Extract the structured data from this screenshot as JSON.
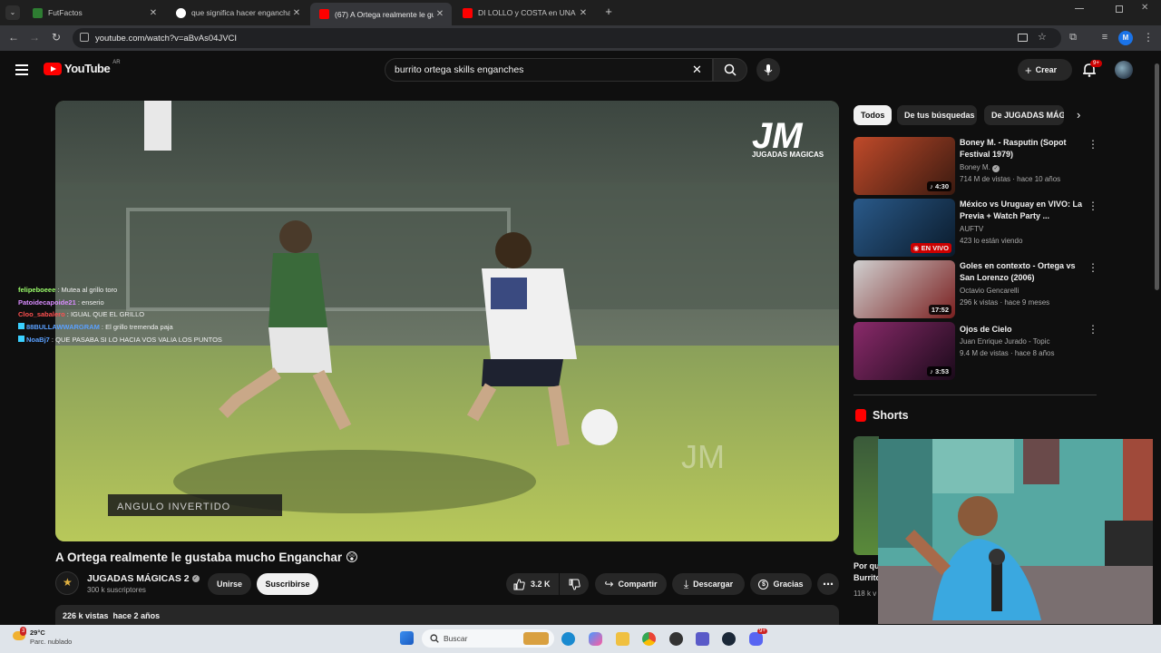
{
  "browser": {
    "tabs": [
      {
        "title": "FutFactos",
        "favicon_color": "#2e7d32"
      },
      {
        "title": "que significa hacer enganchar -",
        "favicon_color": "#ffffff"
      },
      {
        "title": "(67) A Ortega realmente le gust",
        "favicon_color": "#ff0000"
      },
      {
        "title": "DI LOLLO y COSTA en UNA BOM",
        "favicon_color": "#ff0000"
      }
    ],
    "active_tab_index": 2,
    "new_tab_icon": "plus-icon",
    "url": "youtube.com/watch?v=aBvAs04JVCI",
    "profile_initial": "M"
  },
  "youtube": {
    "logo_word": "YouTube",
    "country_code": "AR",
    "search_query": "burrito ortega skills enganches",
    "create_label": "Crear",
    "notification_badge": "9+",
    "player": {
      "watermark": "JM",
      "watermark_sub": "JUGADAS MAGICAS",
      "caption_overlay": "ANGULO INVERTIDO"
    },
    "chat_overlay": [
      {
        "user": "felipeboeee",
        "user_color": "#9cff6b",
        "message": "Mutea al grillo toro",
        "has_icon": false
      },
      {
        "user": "Patoidecapoide21",
        "user_color": "#d98cff",
        "message": "enserio",
        "has_icon": false
      },
      {
        "user": "Cloo_sabalero",
        "user_color": "#ff5050",
        "message": "IGUAL QUE EL GRILLO",
        "has_icon": false
      },
      {
        "user": "88BULLAWWARGRAM",
        "user_color": "#5aa0ff",
        "message": "El grillo tremenda paja",
        "has_icon": true
      },
      {
        "user": "NoaBj7",
        "user_color": "#5aa0ff",
        "message": "QUE PASABA SI LO HACIA VOS VALIA LOS PUNTOS",
        "has_icon": true
      }
    ],
    "video": {
      "title": "A Ortega realmente le gustaba mucho Enganchar 😲",
      "channel": "JUGADAS MÁGICAS 2",
      "subscribers": "300 k suscriptores",
      "join_label": "Unirse",
      "subscribe_label": "Suscribirse",
      "likes": "3.2 K",
      "share_label": "Compartir",
      "download_label": "Descargar",
      "thanks_label": "Gracias",
      "views_date": "226 k vistas  hace 2 años"
    },
    "chips": [
      "Todos",
      "De tus búsquedas",
      "De JUGADAS MÁGICAS"
    ],
    "recommendations": [
      {
        "title": "Boney M. - Rasputin (Sopot Festival 1979)",
        "channel": "Boney M.",
        "verified": true,
        "meta": "714 M de vistas · hace 10 años",
        "duration": "4:30",
        "live": false,
        "thumb_a": "#c04a2a",
        "thumb_b": "#3a1a10"
      },
      {
        "title": "México vs Uruguay en VIVO: La Previa + Watch Party ...",
        "channel": "AUFTV",
        "verified": false,
        "meta": "423 lo están viendo",
        "duration": "EN VIVO",
        "live": true,
        "thumb_a": "#2a5a8a",
        "thumb_b": "#0a1a2a"
      },
      {
        "title": "Goles en contexto - Ortega vs San Lorenzo (2006)",
        "channel": "Octavio Gencarelli",
        "verified": false,
        "meta": "296 k vistas · hace 9 meses",
        "duration": "17:52",
        "live": false,
        "thumb_a": "#d0d0d0",
        "thumb_b": "#7a2020"
      },
      {
        "title": "Ojos de Cielo",
        "channel": "Juan Enrique Jurado - Topic",
        "verified": false,
        "meta": "9.4 M de vistas · hace 8 años",
        "duration": "3:53",
        "live": false,
        "thumb_a": "#8a2a6a",
        "thumb_b": "#1a0a1a"
      }
    ],
    "shorts_label": "Shorts",
    "shorts_partial_title": "Por qu\nBurrito",
    "shorts_partial_meta": "118 k v"
  },
  "taskbar": {
    "weather_badge": "3",
    "temperature": "29°C",
    "condition": "Parc. nublado",
    "search_placeholder": "Buscar",
    "notification_badge": "9+"
  }
}
